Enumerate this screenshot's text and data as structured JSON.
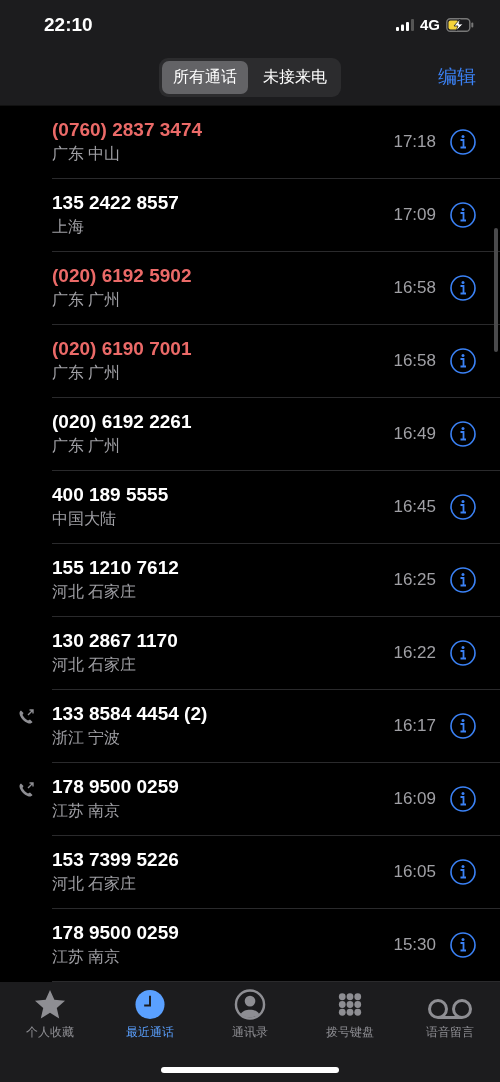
{
  "status_bar": {
    "time": "22:10",
    "network": "4G"
  },
  "nav": {
    "segments": [
      {
        "label": "所有通话",
        "selected": true
      },
      {
        "label": "未接来电",
        "selected": false
      }
    ],
    "edit": "编辑"
  },
  "calls": [
    {
      "number": "(0760) 2837 3474",
      "location": "广东 中山",
      "time": "17:18",
      "missed": true,
      "outgoing": false
    },
    {
      "number": "135 2422 8557",
      "location": "上海",
      "time": "17:09",
      "missed": false,
      "outgoing": false
    },
    {
      "number": "(020) 6192 5902",
      "location": "广东 广州",
      "time": "16:58",
      "missed": true,
      "outgoing": false
    },
    {
      "number": "(020) 6190 7001",
      "location": "广东 广州",
      "time": "16:58",
      "missed": true,
      "outgoing": false
    },
    {
      "number": "(020) 6192 2261",
      "location": "广东 广州",
      "time": "16:49",
      "missed": false,
      "outgoing": false
    },
    {
      "number": "400 189 5555",
      "location": "中国大陆",
      "time": "16:45",
      "missed": false,
      "outgoing": false
    },
    {
      "number": "155 1210 7612",
      "location": "河北 石家庄",
      "time": "16:25",
      "missed": false,
      "outgoing": false
    },
    {
      "number": "130 2867 1170",
      "location": "河北 石家庄",
      "time": "16:22",
      "missed": false,
      "outgoing": false
    },
    {
      "number": "133 8584 4454 (2)",
      "location": "浙江 宁波",
      "time": "16:17",
      "missed": false,
      "outgoing": true
    },
    {
      "number": "178 9500 0259",
      "location": "江苏 南京",
      "time": "16:09",
      "missed": false,
      "outgoing": true
    },
    {
      "number": "153 7399 5226",
      "location": "河北 石家庄",
      "time": "16:05",
      "missed": false,
      "outgoing": false
    },
    {
      "number": "178 9500 0259",
      "location": "江苏 南京",
      "time": "15:30",
      "missed": false,
      "outgoing": false
    }
  ],
  "tab_bar": [
    {
      "label": "个人收藏",
      "kind": "star",
      "selected": false
    },
    {
      "label": "最近通话",
      "kind": "clock",
      "selected": true
    },
    {
      "label": "通讯录",
      "kind": "person",
      "selected": false
    },
    {
      "label": "拨号键盘",
      "kind": "keypad",
      "selected": false
    },
    {
      "label": "语音留言",
      "kind": "voicemail",
      "selected": false
    }
  ]
}
